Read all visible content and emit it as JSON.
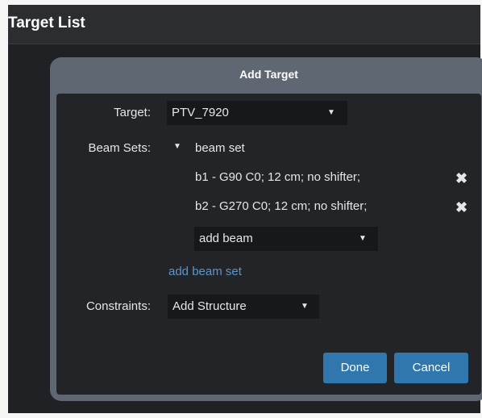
{
  "panel": {
    "title": "Target List"
  },
  "dialog": {
    "title": "Add Target",
    "target": {
      "label": "Target:",
      "selected": "PTV_7920",
      "caret": "▼"
    },
    "beam_sets": {
      "label": "Beam Sets:",
      "set_toggle": "▼",
      "set_name": "beam set",
      "beams": [
        {
          "label": "b1 - G90 C0; 12 cm; no shifter;",
          "remove": "✖"
        },
        {
          "label": "b2 - G270 C0; 12 cm; no shifter;",
          "remove": "✖"
        }
      ],
      "add_beam": {
        "label": "add beam",
        "caret": "▼"
      },
      "add_beam_set": "add beam set"
    },
    "constraints": {
      "label": "Constraints:",
      "selected": "Add Structure",
      "caret": "▼"
    },
    "buttons": {
      "done": "Done",
      "cancel": "Cancel"
    }
  }
}
